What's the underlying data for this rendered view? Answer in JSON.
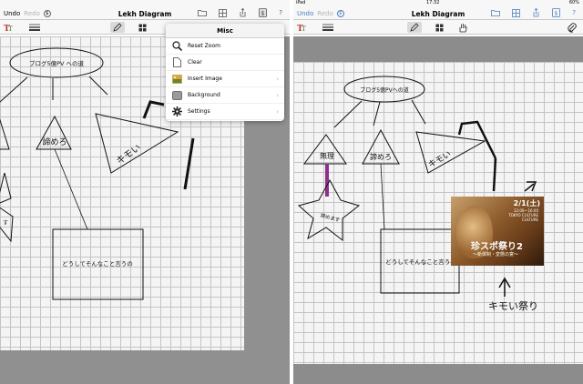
{
  "left": {
    "navbar": {
      "undo": "Undo",
      "redo": "Redo",
      "title": "Lekh Diagram",
      "help": "?"
    },
    "diagram": {
      "ellipse_text": "ブログ5億PV への道",
      "triangle_center": "諦めろ",
      "triangle_right": "キモい",
      "star_text": "す",
      "rect_text": "どうしてそんなこと言うの"
    },
    "popover": {
      "title": "Misc",
      "items": [
        {
          "label": "Reset Zoom",
          "icon": "magnifier-icon",
          "has_submenu": false
        },
        {
          "label": "Clear",
          "icon": "blank-page-icon",
          "has_submenu": false
        },
        {
          "label": "Insert Image",
          "icon": "image-icon",
          "has_submenu": true
        },
        {
          "label": "Background",
          "icon": "background-icon",
          "has_submenu": true
        },
        {
          "label": "Settings",
          "icon": "gear-icon",
          "has_submenu": true
        }
      ],
      "chevron": "›"
    }
  },
  "right": {
    "statusbar": {
      "device": "iPad",
      "time": "17:32",
      "battery": "60%"
    },
    "navbar": {
      "undo": "Undo",
      "redo": "Redo",
      "title": "Lekh Diagram",
      "help": "?"
    },
    "diagram": {
      "ellipse_text": "ブログ5億PVへの道",
      "triangle_left": "無理",
      "triangle_center": "諦めろ",
      "triangle_right": "キモい",
      "star_text": "諦めます",
      "rect_text": "どうしてそんなこと言うの",
      "annotation": "キモい祭り"
    },
    "photo": {
      "date": "2/1(土)",
      "subtext": "12:00〜16:00\nTOKYO CULTURE\nCULTURE",
      "title": "珍スポ祭り2",
      "subtitle": "〜新体制・変態の宴〜"
    }
  },
  "colors": {
    "accent": "#4a7fc1",
    "purple": "#8e2f8e",
    "grid": "#c4c4c4"
  }
}
